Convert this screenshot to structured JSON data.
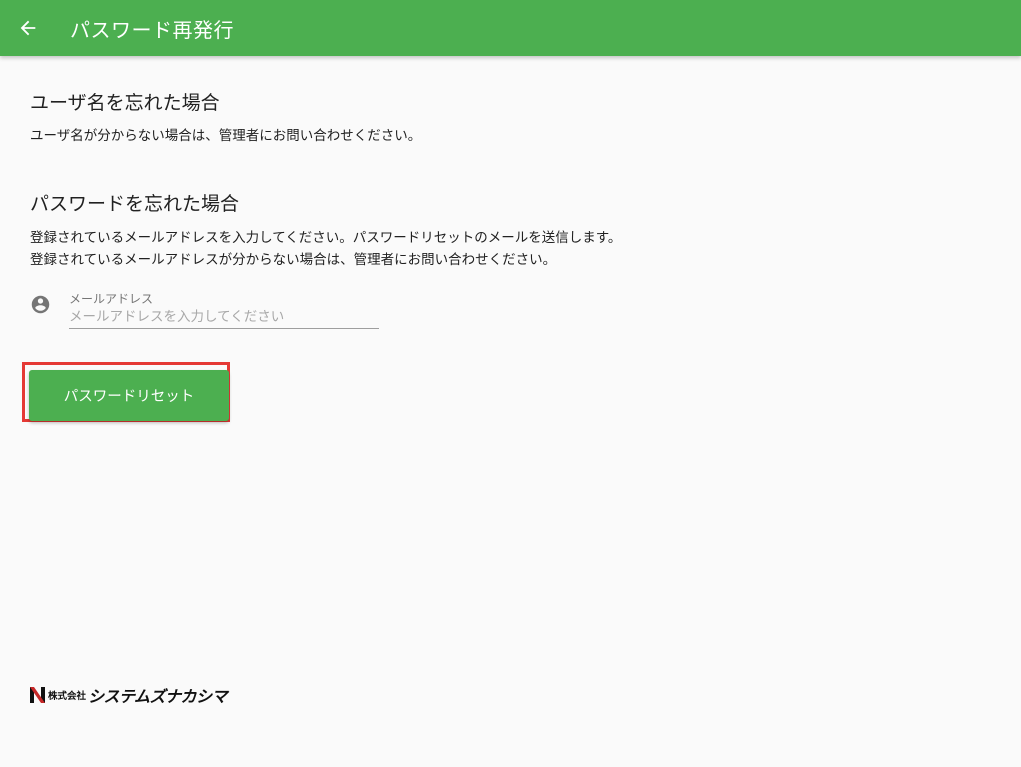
{
  "app_bar": {
    "title": "パスワード再発行",
    "back_icon": "arrow-left-icon",
    "color": "#4caf50"
  },
  "username_section": {
    "heading": "ユーザ名を忘れた場合",
    "description": "ユーザ名が分からない場合は、管理者にお問い合わせください。"
  },
  "password_section": {
    "heading": "パスワードを忘れた場合",
    "description_line1": "登録されているメールアドレスを入力してください。パスワードリセットのメールを送信します。",
    "description_line2": "登録されているメールアドレスが分からない場合は、管理者にお問い合わせください。"
  },
  "email_field": {
    "icon": "account-circle-icon",
    "label": "メールアドレス",
    "placeholder": "メールアドレスを入力してください",
    "value": ""
  },
  "reset_button": {
    "label": "パスワードリセット",
    "color": "#4caf50",
    "highlight_color": "#e53935"
  },
  "footer": {
    "logo_prefix": "株式会社",
    "logo_name": "システムズナカシマ",
    "logo_mark_color": "#c62828"
  }
}
